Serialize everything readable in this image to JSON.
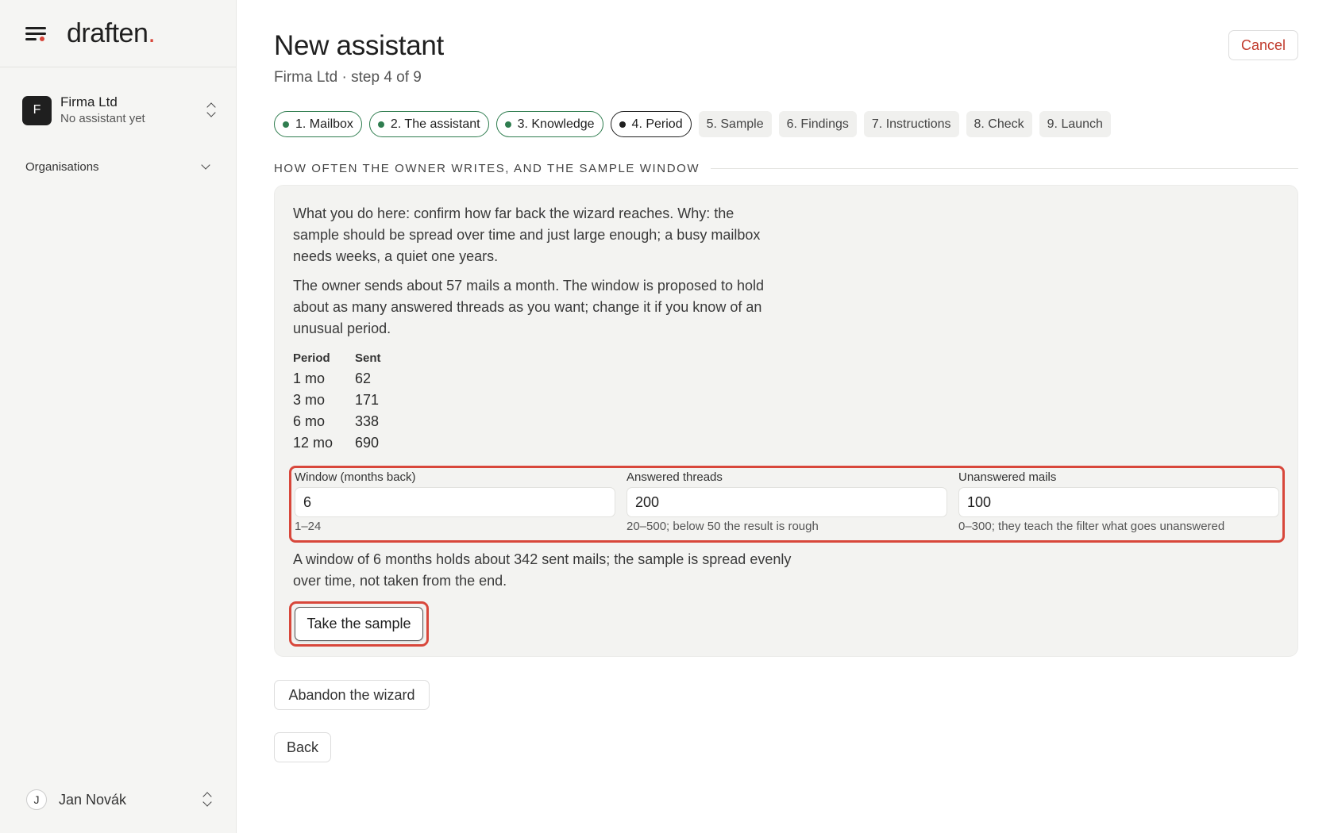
{
  "sidebar": {
    "logo_text": "draften",
    "logo_dot": ".",
    "org": {
      "avatar_letter": "F",
      "name": "Firma Ltd",
      "sub": "No assistant yet"
    },
    "organisations_label": "Organisations",
    "user": {
      "avatar_letter": "J",
      "name": "Jan Novák"
    }
  },
  "header": {
    "title": "New assistant",
    "subtitle": "Firma Ltd · step 4 of 9",
    "cancel_label": "Cancel"
  },
  "steps": [
    {
      "label": "1. Mailbox",
      "state": "done"
    },
    {
      "label": "2. The assistant",
      "state": "done"
    },
    {
      "label": "3. Knowledge",
      "state": "done"
    },
    {
      "label": "4. Period",
      "state": "current"
    },
    {
      "label": "5. Sample",
      "state": "todo"
    },
    {
      "label": "6. Findings",
      "state": "todo"
    },
    {
      "label": "7. Instructions",
      "state": "todo"
    },
    {
      "label": "8. Check",
      "state": "todo"
    },
    {
      "label": "9. Launch",
      "state": "todo"
    }
  ],
  "section": {
    "heading": "HOW OFTEN THE OWNER WRITES, AND THE SAMPLE WINDOW",
    "intro": "What you do here: confirm how far back the wizard reaches. Why: the sample should be spread over time and just large enough; a busy mailbox needs weeks, a quiet one years.",
    "volume_text": "The owner sends about 57 mails a month. The window is proposed to hold about as many answered threads as you want; change it if you know of an unusual period.",
    "table": {
      "headers": [
        "Period",
        "Sent"
      ],
      "rows": [
        [
          "1 mo",
          "62"
        ],
        [
          "3 mo",
          "171"
        ],
        [
          "6 mo",
          "338"
        ],
        [
          "12 mo",
          "690"
        ]
      ]
    },
    "fields": {
      "window": {
        "label": "Window (months back)",
        "value": "6",
        "hint": "1–24"
      },
      "answered": {
        "label": "Answered threads",
        "value": "200",
        "hint": "20–500; below 50 the result is rough"
      },
      "unanswered": {
        "label": "Unanswered mails",
        "value": "100",
        "hint": "0–300; they teach the filter what goes unanswered"
      }
    },
    "summary": "A window of 6 months holds about 342 sent mails; the sample is spread evenly over time, not taken from the end.",
    "sample_button": "Take the sample"
  },
  "footer": {
    "abandon_label": "Abandon the wizard",
    "back_label": "Back"
  },
  "colors": {
    "accent_red": "#d8473b",
    "done_green": "#2f7d4f",
    "cancel_red": "#c0392b"
  }
}
